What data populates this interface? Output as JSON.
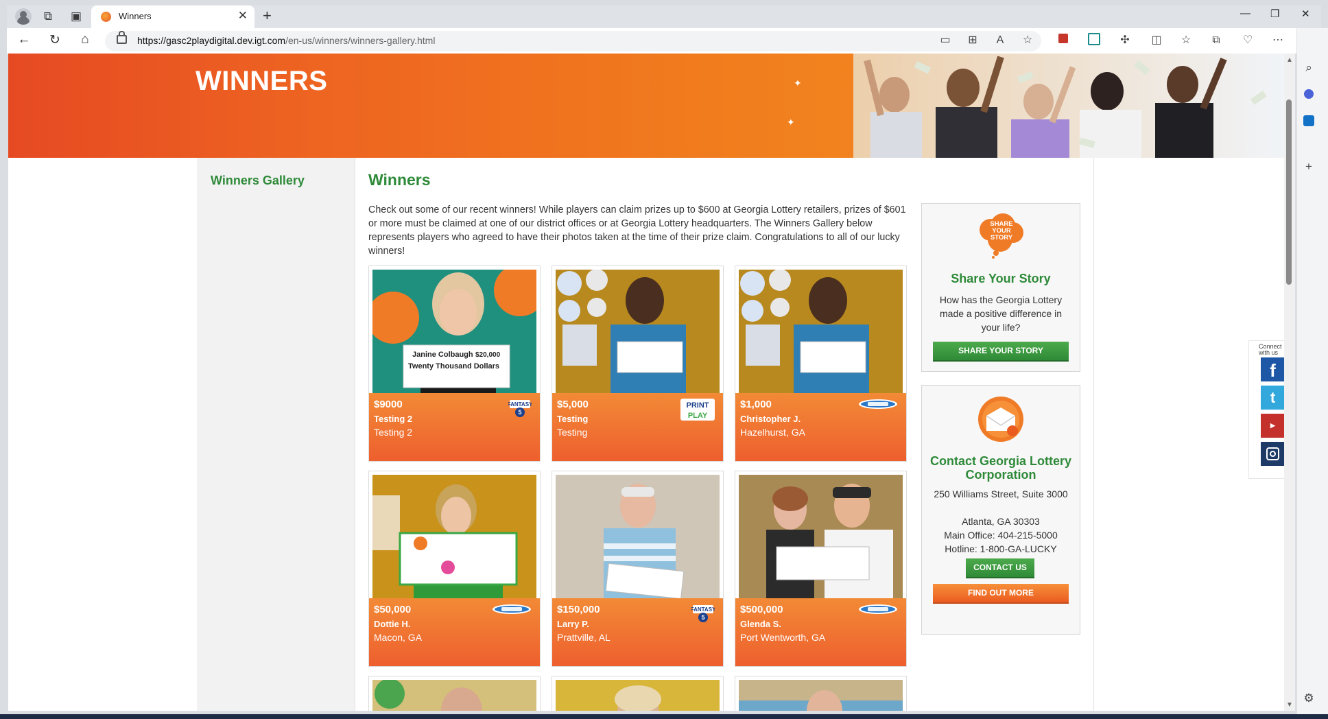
{
  "browser": {
    "tab_title": "Winners",
    "url_host": "https://gasc2playdigital.dev.igt.com",
    "url_path": "/en-us/winners/winners-gallery.html"
  },
  "hero": {
    "title": "WINNERS"
  },
  "sidebar": {
    "link": "Winners Gallery"
  },
  "main": {
    "title": "Winners",
    "intro": "Check out some of our recent winners! While players can claim prizes up to $600 at Georgia Lottery retailers, prizes of $601 or more must be claimed at one of our district offices or at Georgia Lottery headquarters. The Winners Gallery below represents players who agreed to have their photos taken at the time of their prize claim. Congratulations to all of our lucky winners!"
  },
  "cards": [
    {
      "amount": "$9000",
      "name": "Testing 2",
      "location": "Testing 2",
      "game": "fantasy5",
      "check_name": "Janine Colbaugh",
      "check_amount": "$20,000",
      "check_words": "Twenty Thousand Dollars"
    },
    {
      "amount": "$5,000",
      "name": "Testing",
      "location": "Testing",
      "game": "print-n-play"
    },
    {
      "amount": "$1,000",
      "name": "Christopher J.",
      "location": "Hazelhurst, GA",
      "game": "scratchers"
    },
    {
      "amount": "$50,000",
      "name": "Dottie H.",
      "location": "Macon, GA",
      "game": "scratchers"
    },
    {
      "amount": "$150,000",
      "name": "Larry P.",
      "location": "Prattville, AL",
      "game": "fantasy5"
    },
    {
      "amount": "$500,000",
      "name": "Glenda S.",
      "location": "Port Wentworth, GA",
      "game": "scratchers"
    }
  ],
  "share": {
    "icon_text": "SHARE YOUR STORY",
    "title": "Share Your Story",
    "text": "How has the Georgia Lottery made a positive difference in your life?",
    "button": "SHARE YOUR STORY"
  },
  "contact": {
    "title": "Contact Georgia Lottery Corporation",
    "address1": "250 Williams Street, Suite 3000",
    "address2": "Atlanta, GA 30303",
    "main_office": "Main Office: 404-215-5000",
    "hotline": "Hotline: 1-800-GA-LUCKY",
    "contact_button": "CONTACT US",
    "more_button": "FIND OUT MORE"
  },
  "social": {
    "label": "Connect with us",
    "items": [
      "facebook",
      "twitter",
      "youtube",
      "instagram"
    ]
  },
  "colors": {
    "brand_green": "#2e8a39",
    "brand_orange": "#ef6a2a",
    "hero_start": "#e64a23",
    "hero_end": "#f39624"
  }
}
